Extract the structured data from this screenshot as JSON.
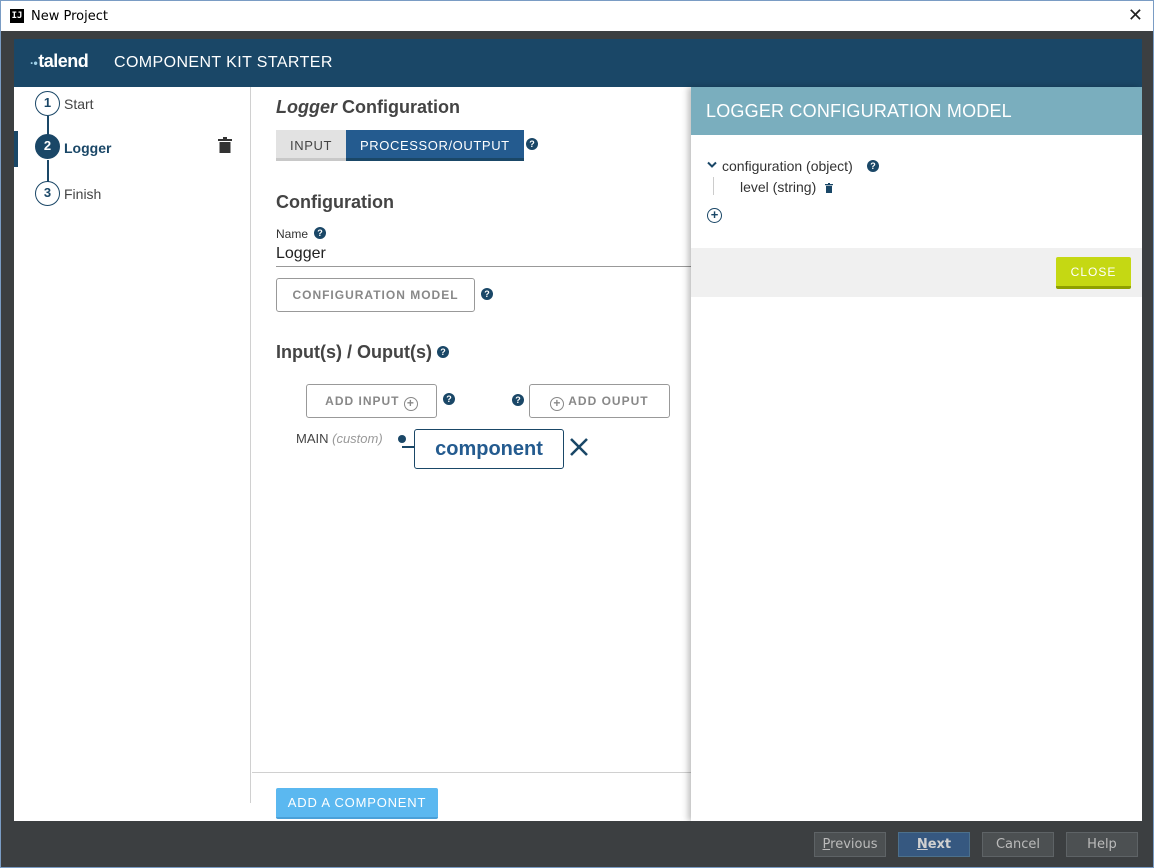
{
  "window": {
    "title": "New Project",
    "icon_text": "IJ",
    "close_glyph": "✕"
  },
  "header": {
    "logo": "talend",
    "app_title": "COMPONENT KIT STARTER"
  },
  "steps": [
    {
      "number": "1",
      "label": "Start"
    },
    {
      "number": "2",
      "label": "Logger"
    },
    {
      "number": "3",
      "label": "Finish"
    }
  ],
  "main": {
    "title_italic": "Logger",
    "title_rest": " Configuration",
    "tabs": [
      {
        "label": "INPUT"
      },
      {
        "label": "PROCESSOR/OUTPUT"
      }
    ],
    "configuration_title": "Configuration",
    "name_label": "Name",
    "name_value": "Logger",
    "configuration_model_button": "CONFIGURATION MODEL",
    "io_title": "Input(s) / Ouput(s)",
    "add_input_button": "ADD INPUT",
    "add_output_button": "ADD OUPUT",
    "main_port_label": "MAIN",
    "main_port_type": "(custom)",
    "component_label": "component",
    "add_component_button": "ADD A COMPONENT"
  },
  "panel": {
    "title": "LOGGER CONFIGURATION MODEL",
    "tree": {
      "root": "configuration (object)",
      "children": [
        "level (string)"
      ]
    },
    "close_button": "CLOSE"
  },
  "dialog_buttons": {
    "previous_first": "P",
    "previous_rest": "revious",
    "next_first": "N",
    "next_rest": "ext",
    "cancel": "Cancel",
    "help": "Help"
  },
  "colors": {
    "brand_dark": "#1a4767",
    "tab_active": "#245b8f",
    "panel_header": "#7aaebe",
    "close_button": "#c5d813",
    "add_component": "#5bb8f0"
  }
}
